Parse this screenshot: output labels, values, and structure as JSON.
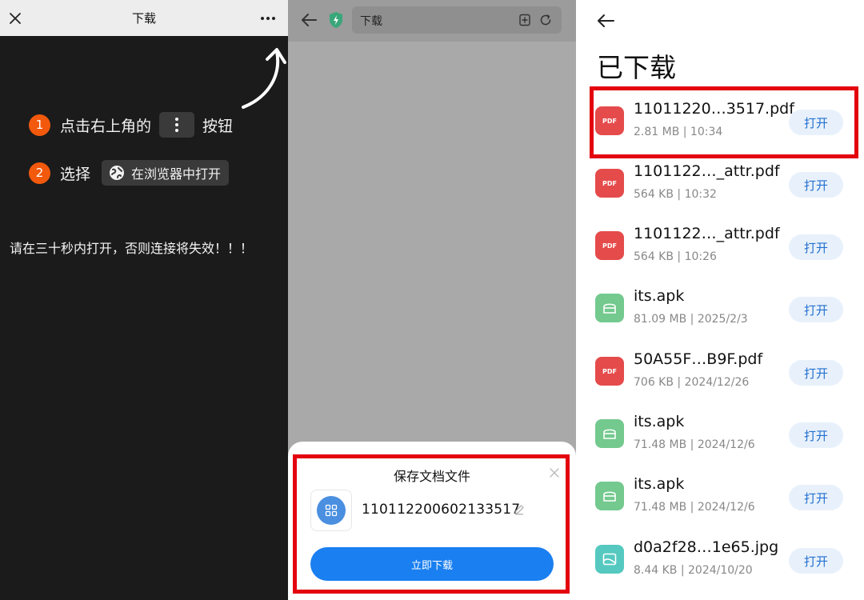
{
  "panel1": {
    "title": "下载",
    "step1": {
      "num": "1",
      "prefix": "点击右上角的",
      "suffix": "按钮"
    },
    "step2": {
      "num": "2",
      "prefix": "选择",
      "chip": "在浏览器中打开"
    },
    "warning": "请在三十秒内打开，否则连接将失效！！！"
  },
  "panel2": {
    "url_text": "下载",
    "sheet": {
      "title": "保存文档文件",
      "file_name": "110112200602133517",
      "download_label": "立即下载"
    }
  },
  "panel3": {
    "title": "已下载",
    "open_label": "打开",
    "items": [
      {
        "name": "11011220…3517.pdf",
        "meta": "2.81 MB | 10:34",
        "type": "pdf",
        "icon_text": "PDF"
      },
      {
        "name": "1101122…_attr.pdf",
        "meta": "564 KB | 10:32",
        "type": "pdf",
        "icon_text": "PDF"
      },
      {
        "name": "1101122…_attr.pdf",
        "meta": "564 KB | 10:26",
        "type": "pdf",
        "icon_text": "PDF"
      },
      {
        "name": "its.apk",
        "meta": "81.09 MB | 2025/2/3",
        "type": "apk",
        "icon_text": ""
      },
      {
        "name": "50A55F…B9F.pdf",
        "meta": "706 KB | 2024/12/26",
        "type": "pdf",
        "icon_text": "PDF"
      },
      {
        "name": "its.apk",
        "meta": "71.48 MB | 2024/12/6",
        "type": "apk",
        "icon_text": ""
      },
      {
        "name": "its.apk",
        "meta": "71.48 MB | 2024/12/6",
        "type": "apk",
        "icon_text": ""
      },
      {
        "name": "d0a2f28…1e65.jpg",
        "meta": "8.44 KB | 2024/10/20",
        "type": "jpg",
        "icon_text": ""
      }
    ]
  },
  "colors": {
    "highlight": "#e3020e",
    "step_badge": "#f2590c",
    "primary_button": "#1a7ff0",
    "pdf_icon": "#e54b4b",
    "apk_icon": "#73c98e",
    "jpg_icon": "#55c9c0"
  },
  "icons": [
    "close-icon",
    "more-dots-icon",
    "curved-arrow-icon",
    "globe-icon",
    "back-arrow-icon",
    "shield-icon",
    "bookmark-icon",
    "refresh-icon",
    "apps-grid-icon",
    "pencil-icon",
    "pdf-file-icon",
    "apk-file-icon",
    "image-file-icon"
  ]
}
